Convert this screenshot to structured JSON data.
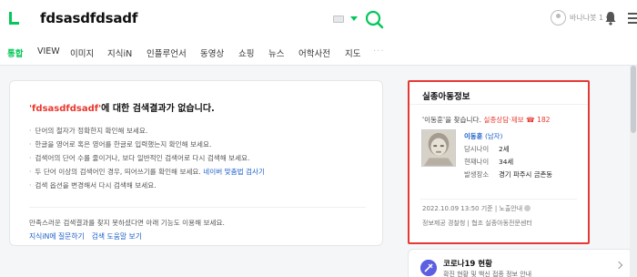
{
  "search": {
    "query": "fdsasdfdsadf"
  },
  "header": {
    "username": "바나나봇 1 ▾"
  },
  "tabs": [
    "통합",
    "VIEW",
    "이미지",
    "지식iN",
    "인플루언서",
    "동영상",
    "쇼핑",
    "뉴스",
    "어학사전",
    "지도"
  ],
  "tabs_more": "···",
  "no_result": {
    "query_quoted": "'fdsasdfdsadf'",
    "message": "에 대한 검색결과가 없습니다.",
    "tips": [
      "단어의 철자가 정확한지 확인해 보세요.",
      "한글을 영어로 혹은 영어를 한글로 입력했는지 확인해 보세요.",
      "검색어의 단어 수를 줄이거나, 보다 일반적인 검색어로 다시 검색해 보세요.",
      "두 단어 이상의 검색어인 경우, 띄어쓰기를 확인해 보세요.",
      "검색 옵션을 변경해서 다시 검색해 보세요."
    ],
    "spellcheck_link": "네이버 맞춤법 검사기",
    "bottom_text": "만족스러운 검색결과를 찾지 못하셨다면 아래 기능도 이용해 보세요.",
    "links": [
      "지식iN에 질문하기",
      "검색 도움말 보기"
    ]
  },
  "missing_child": {
    "title": "실종아동정보",
    "find_text": "'이동훈'을 찾습니다.",
    "report_label": "실종상담·제보",
    "report_number": "182",
    "name": "이동훈",
    "gender": "(남자)",
    "rows": [
      {
        "key": "당시나이",
        "value": "2세"
      },
      {
        "key": "현재나이",
        "value": "34세"
      },
      {
        "key": "발생장소",
        "value": "경기 파주시 금촌동"
      }
    ],
    "timestamp": "2022.10.09 13:50 기준",
    "exposure": "노출안내",
    "provider_label": "정보제공",
    "provider": "경찰청",
    "cooperation_label": "협조",
    "cooperation": "실종아동전문센터"
  },
  "corona": {
    "title": "코로나19 현황",
    "subtitle": "확진 현황 및 백신 접종 정보 안내"
  },
  "colors": {
    "naver_green": "#03c75a",
    "link_blue": "#1a5ec8",
    "alert_red": "#e8382d",
    "highlight_border": "#e53935"
  }
}
